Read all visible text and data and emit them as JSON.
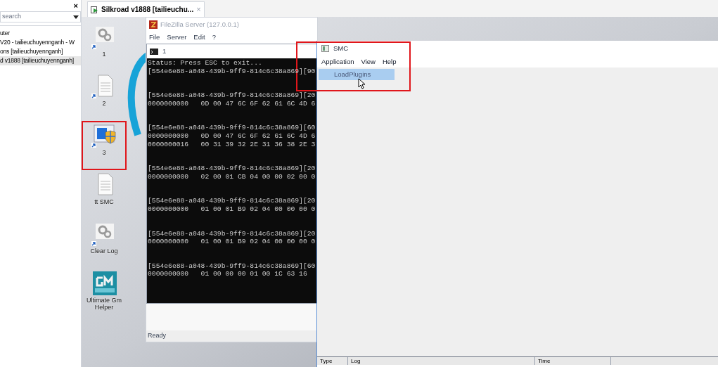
{
  "library_panel": {
    "close": "×",
    "search_placeholder": "search",
    "items": [
      {
        "label": "uter",
        "selected": false
      },
      {
        "label": "V20 - tailieuchuyennganh - W",
        "selected": false
      },
      {
        "label": "ons  [tailieuchuyennganh]",
        "selected": false
      },
      {
        "label": "d v1888 [tailieuchuyennganh]",
        "selected": true
      }
    ]
  },
  "vm_tab": {
    "title": "Silkroad v1888 [tailieuchu...",
    "close": "×"
  },
  "desktop_icons": [
    {
      "label": "1",
      "kind": "gear",
      "shortcut": true,
      "highlighted": false
    },
    {
      "label": "2",
      "kind": "document",
      "shortcut": true,
      "highlighted": false
    },
    {
      "label": "3",
      "kind": "shield",
      "shortcut": true,
      "highlighted": true
    },
    {
      "label": "tt SMC",
      "kind": "document",
      "shortcut": false,
      "highlighted": false
    },
    {
      "label": "Clear Log",
      "kind": "gear",
      "shortcut": true,
      "highlighted": false
    },
    {
      "label": "Ultimate Gm Helper",
      "kind": "gm",
      "shortcut": false,
      "highlighted": false
    }
  ],
  "filezilla": {
    "title": "FileZilla Server (127.0.0.1)",
    "menu": [
      "File",
      "Server",
      "Edit",
      "?"
    ],
    "status": "Ready"
  },
  "console": {
    "title": "1",
    "groups": [
      [
        "Status: Press ESC to exit...",
        "[554e6e88-a048-439b-9ff9-814c6c38a869][90"
      ],
      [
        "[554e6e88-a048-439b-9ff9-814c6c38a869][20",
        "0000000000   0D 00 47 6C 6F 62 61 6C 4D 6"
      ],
      [
        "[554e6e88-a048-439b-9ff9-814c6c38a869][60",
        "0000000000   0D 00 47 6C 6F 62 61 6C 4D 6",
        "0000000016   00 31 39 32 2E 31 36 38 2E 3"
      ],
      [
        "[554e6e88-a048-439b-9ff9-814c6c38a869][20",
        "0000000000   02 00 01 CB 04 00 00 02 00 0"
      ],
      [
        "[554e6e88-a048-439b-9ff9-814c6c38a869][20",
        "0000000000   01 00 01 B9 02 04 00 00 00 0"
      ],
      [
        "[554e6e88-a048-439b-9ff9-814c6c38a869][20",
        "0000000000   01 00 01 B9 02 04 00 00 00 0"
      ],
      [
        "[554e6e88-a048-439b-9ff9-814c6c38a869][60",
        "0000000000   01 00 00 00 01 00 1C 63 16"
      ]
    ]
  },
  "smc": {
    "title": "SMC",
    "highlighted": true,
    "menu": [
      "Application",
      "View",
      "Help"
    ],
    "dropdown_items": [
      {
        "label": "LoadPlugins",
        "selected": true
      }
    ],
    "columns": [
      "Type",
      "Log",
      "Time"
    ]
  }
}
